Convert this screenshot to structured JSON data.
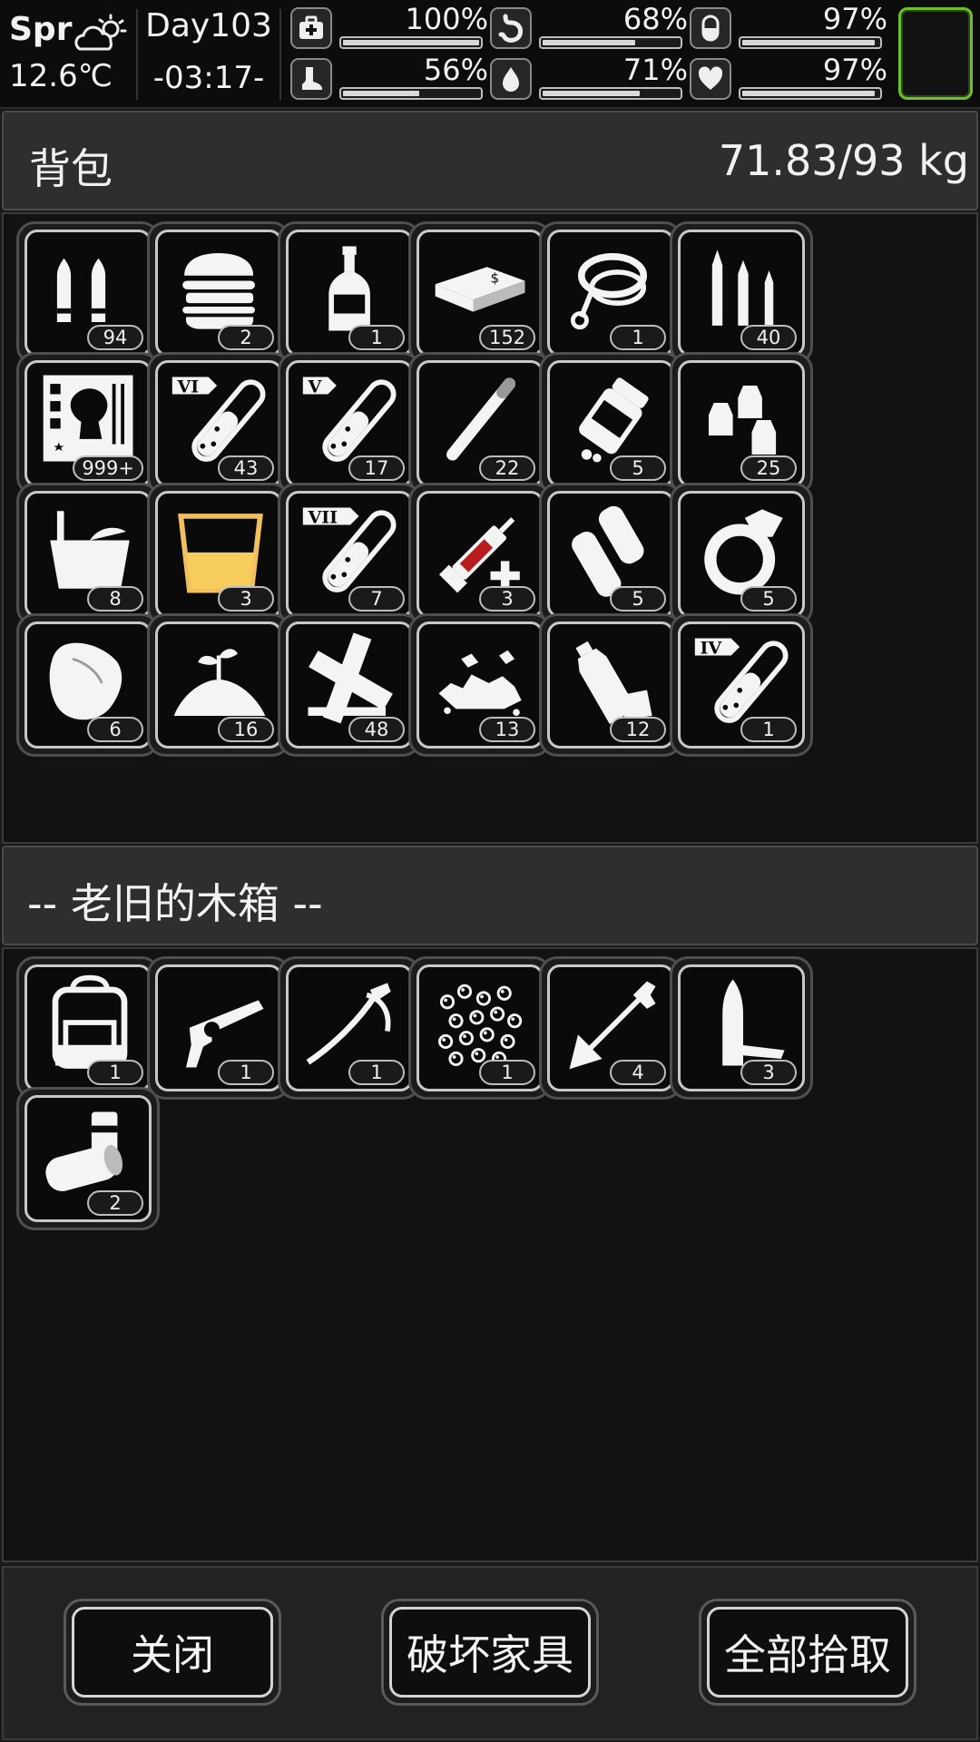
{
  "hud": {
    "season": "Spr",
    "weather_icon": "partly-cloudy-icon",
    "temperature": "12.6℃",
    "day": "Day103",
    "time": "-03:17-",
    "stats": [
      {
        "name": "health",
        "icon": "medkit-icon",
        "value": "100%",
        "level": 1.0
      },
      {
        "name": "hunger",
        "icon": "stomach-icon",
        "value": "68%",
        "level": 0.68
      },
      {
        "name": "mental",
        "icon": "pill-icon",
        "value": "97%",
        "level": 0.97
      },
      {
        "name": "stamina",
        "icon": "foot-icon",
        "value": "56%",
        "level": 0.56
      },
      {
        "name": "thirst",
        "icon": "water-drop-icon",
        "value": "71%",
        "level": 0.71
      },
      {
        "name": "mood",
        "icon": "heart-icon",
        "value": "97%",
        "level": 0.97
      }
    ],
    "accent_color": "#6fbf2b"
  },
  "backpack": {
    "title": "背包",
    "weight": "71.83/93 kg",
    "items": [
      {
        "icon": "pistol-ammo-icon",
        "count": "94"
      },
      {
        "icon": "burger-icon",
        "count": "2"
      },
      {
        "icon": "liquor-bottle-icon",
        "count": "1"
      },
      {
        "icon": "cash-stack-icon",
        "count": "152"
      },
      {
        "icon": "rope-icon",
        "count": "1"
      },
      {
        "icon": "rifle-ammo-icon",
        "count": "40"
      },
      {
        "icon": "zombie-card-icon",
        "count": "999+"
      },
      {
        "icon": "test-tube-vi-icon",
        "count": "43"
      },
      {
        "icon": "test-tube-v-icon",
        "count": "17"
      },
      {
        "icon": "cigarette-icon",
        "count": "22"
      },
      {
        "icon": "pill-bottle-icon",
        "count": "5"
      },
      {
        "icon": "seed-bags-icon",
        "count": "25"
      },
      {
        "icon": "bucket-icon",
        "count": "8"
      },
      {
        "icon": "juice-glass-icon",
        "count": "3"
      },
      {
        "icon": "test-tube-vii-icon",
        "count": "7"
      },
      {
        "icon": "syringe-icon",
        "count": "3"
      },
      {
        "icon": "cloth-roll-icon",
        "count": "5"
      },
      {
        "icon": "diamond-ring-icon",
        "count": "5"
      },
      {
        "icon": "leather-icon",
        "count": "6"
      },
      {
        "icon": "soil-sprout-icon",
        "count": "16"
      },
      {
        "icon": "wood-planks-icon",
        "count": "48"
      },
      {
        "icon": "stone-rubble-icon",
        "count": "13"
      },
      {
        "icon": "plastic-bottle-icon",
        "count": "12"
      },
      {
        "icon": "test-tube-iv-icon",
        "count": "1"
      }
    ]
  },
  "container": {
    "title": "-- 老旧的木箱 --",
    "items": [
      {
        "icon": "backpack-icon",
        "count": "1"
      },
      {
        "icon": "revolver-icon",
        "count": "1"
      },
      {
        "icon": "saber-icon",
        "count": "1"
      },
      {
        "icon": "steel-balls-icon",
        "count": "1"
      },
      {
        "icon": "arrow-icon",
        "count": "4"
      },
      {
        "icon": "bullet-casing-icon",
        "count": "3"
      },
      {
        "icon": "shotgun-shells-icon",
        "count": "2"
      }
    ]
  },
  "buttons": {
    "close": "关闭",
    "destroy_furniture": "破坏家具",
    "take_all": "全部拾取"
  }
}
